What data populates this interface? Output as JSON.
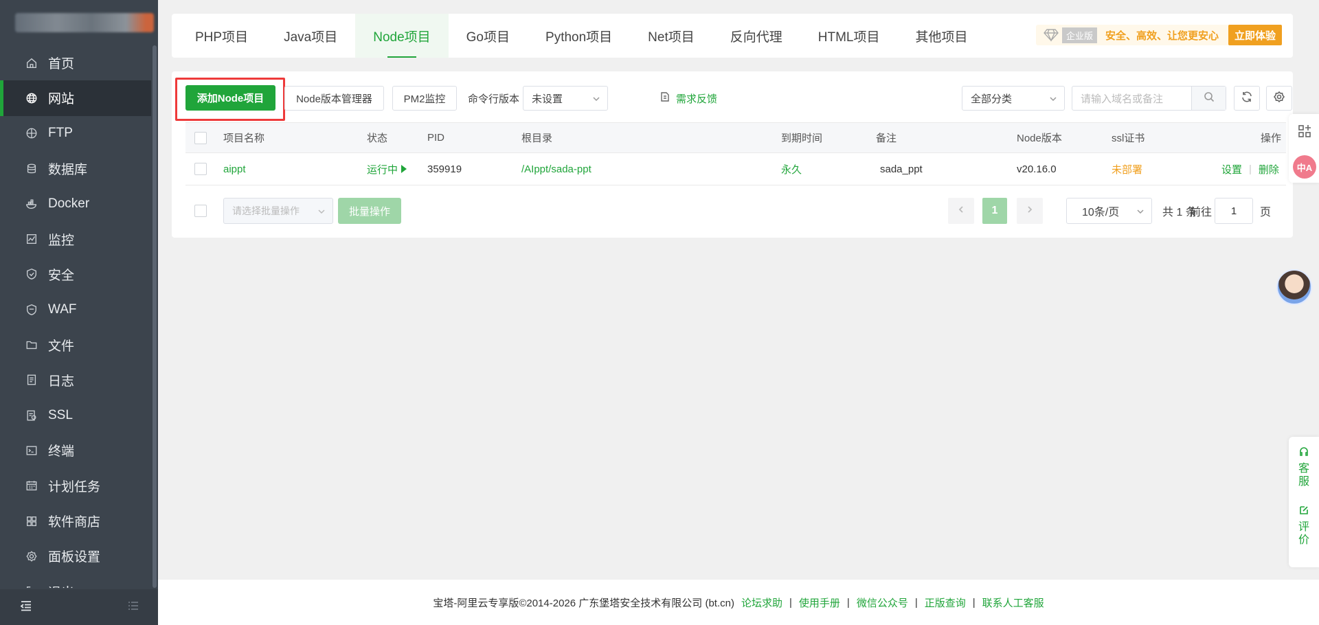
{
  "sidebar": {
    "items": [
      {
        "label": "首页",
        "icon": "home-icon"
      },
      {
        "label": "网站",
        "icon": "globe-icon"
      },
      {
        "label": "FTP",
        "icon": "ftp-icon"
      },
      {
        "label": "数据库",
        "icon": "database-icon"
      },
      {
        "label": "Docker",
        "icon": "docker-icon"
      },
      {
        "label": "监控",
        "icon": "monitor-icon"
      },
      {
        "label": "安全",
        "icon": "shield-icon"
      },
      {
        "label": "WAF",
        "icon": "waf-icon"
      },
      {
        "label": "文件",
        "icon": "folder-icon"
      },
      {
        "label": "日志",
        "icon": "log-icon"
      },
      {
        "label": "SSL",
        "icon": "ssl-icon"
      },
      {
        "label": "终端",
        "icon": "terminal-icon"
      },
      {
        "label": "计划任务",
        "icon": "calendar-icon"
      },
      {
        "label": "软件商店",
        "icon": "apps-icon"
      },
      {
        "label": "面板设置",
        "icon": "settings-icon"
      },
      {
        "label": "退出",
        "icon": "logout-icon"
      }
    ],
    "active_index": 1
  },
  "tabs": [
    "PHP项目",
    "Java项目",
    "Node项目",
    "Go项目",
    "Python项目",
    "Net项目",
    "反向代理",
    "HTML项目",
    "其他项目"
  ],
  "active_tab": 2,
  "promo": {
    "badge": "企业版",
    "text": "安全、高效、让您更安心",
    "button": "立即体验"
  },
  "toolbar": {
    "add_button": "添加Node项目",
    "version_manager": "Node版本管理器",
    "pm2": "PM2监控",
    "cli_label": "命令行版本",
    "cli_value": "未设置",
    "feedback": "需求反馈",
    "category": "全部分类",
    "search_placeholder": "请输入域名或备注"
  },
  "table": {
    "headers": {
      "name": "项目名称",
      "status": "状态",
      "pid": "PID",
      "root": "根目录",
      "expire": "到期时间",
      "remark": "备注",
      "node": "Node版本",
      "ssl": "ssl证书",
      "ops": "操作"
    },
    "rows": [
      {
        "name": "aippt",
        "status": "运行中",
        "pid": "359919",
        "root": "/AIppt/sada-ppt",
        "expire": "永久",
        "remark": "sada_ppt",
        "node": "v20.16.0",
        "ssl": "未部署",
        "op_settings": "设置",
        "op_separator": "|",
        "op_delete": "删除"
      }
    ]
  },
  "batch": {
    "placeholder": "请选择批量操作",
    "button": "批量操作"
  },
  "pagination": {
    "current": "1",
    "page_size": "10条/页",
    "total": "共 1 条",
    "goto_label": "前往",
    "goto_value": "1",
    "page_suffix": "页"
  },
  "footer": {
    "copyright": "宝塔-阿里云专享版©2014-2026 广东堡塔安全技术有限公司 (bt.cn)",
    "links": [
      "论坛求助",
      "使用手册",
      "微信公众号",
      "正版查询",
      "联系人工客服"
    ],
    "separator": "|"
  },
  "float": {
    "translate_label": "中A",
    "service_label": "客服",
    "review_label": "评价"
  },
  "colors": {
    "accent": "#20a53a",
    "sidebar_bg": "#3c444d",
    "warning": "#f0a020",
    "highlight": "#ee3a3a"
  }
}
